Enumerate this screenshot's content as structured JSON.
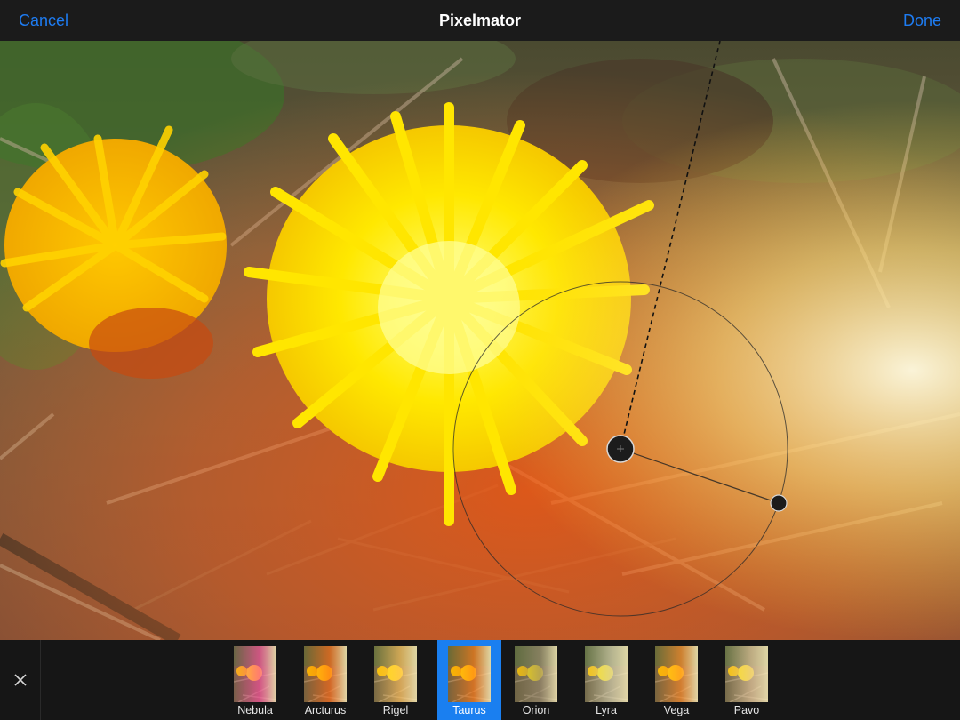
{
  "topbar": {
    "cancel_label": "Cancel",
    "title": "Pixelmator",
    "done_label": "Done"
  },
  "presets": [
    {
      "name": "Nebula",
      "tint": "#ff4fa0",
      "selected": false
    },
    {
      "name": "Arcturus",
      "tint": "#ff6a1a",
      "selected": false
    },
    {
      "name": "Rigel",
      "tint": "#ffc060",
      "selected": false
    },
    {
      "name": "Taurus",
      "tint": "#ff7a1a",
      "selected": true
    },
    {
      "name": "Orion",
      "tint": "#9a8a70",
      "selected": false
    },
    {
      "name": "Lyra",
      "tint": "#d8d0b0",
      "selected": false
    },
    {
      "name": "Vega",
      "tint": "#ff8a2a",
      "selected": false
    },
    {
      "name": "Pavo",
      "tint": "#e8c8a0",
      "selected": false
    }
  ],
  "colors": {
    "accent": "#1e7cf2",
    "selected_bg": "#1a7ff0",
    "bar_bg": "#1b1b1b"
  },
  "icons": {
    "close": "close-icon"
  }
}
